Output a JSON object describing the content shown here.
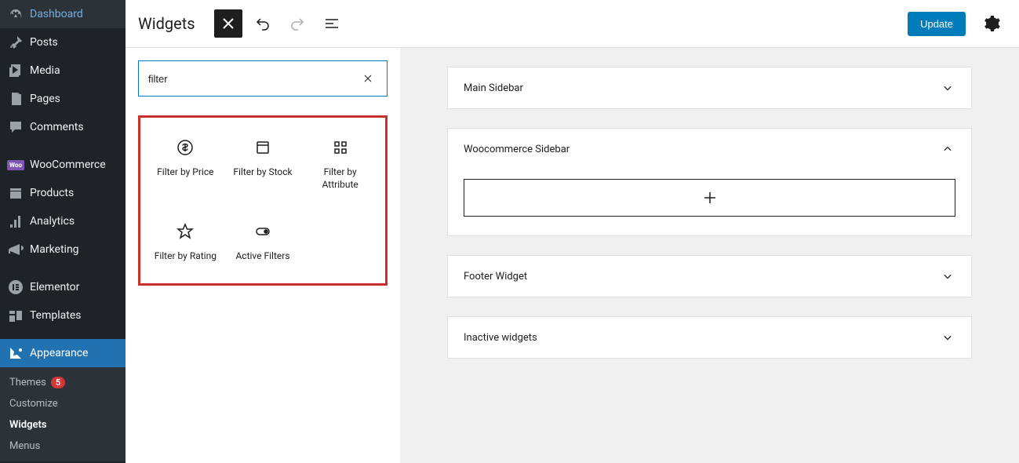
{
  "sidebar": {
    "items": [
      {
        "label": "Dashboard",
        "icon": "dashboard"
      },
      {
        "label": "Posts",
        "icon": "pin"
      },
      {
        "label": "Media",
        "icon": "media"
      },
      {
        "label": "Pages",
        "icon": "pages"
      },
      {
        "label": "Comments",
        "icon": "comments"
      },
      {
        "label": "WooCommerce",
        "icon": "woo"
      },
      {
        "label": "Products",
        "icon": "products"
      },
      {
        "label": "Analytics",
        "icon": "analytics"
      },
      {
        "label": "Marketing",
        "icon": "marketing"
      },
      {
        "label": "Elementor",
        "icon": "elementor"
      },
      {
        "label": "Templates",
        "icon": "templates"
      },
      {
        "label": "Appearance",
        "icon": "appearance"
      }
    ],
    "submenu": [
      {
        "label": "Themes",
        "badge": "5"
      },
      {
        "label": "Customize"
      },
      {
        "label": "Widgets",
        "current": true
      },
      {
        "label": "Menus"
      }
    ]
  },
  "header": {
    "title": "Widgets",
    "update_label": "Update"
  },
  "search": {
    "value": "filter"
  },
  "blocks": [
    {
      "label": "Filter by Price",
      "icon": "price"
    },
    {
      "label": "Filter by Stock",
      "icon": "stock"
    },
    {
      "label": "Filter by Attribute",
      "icon": "attribute"
    },
    {
      "label": "Filter by Rating",
      "icon": "rating"
    },
    {
      "label": "Active Filters",
      "icon": "active"
    }
  ],
  "widget_areas": [
    {
      "title": "Main Sidebar",
      "expanded": false
    },
    {
      "title": "Woocommerce Sidebar",
      "expanded": true
    },
    {
      "title": "Footer Widget",
      "expanded": false
    },
    {
      "title": "Inactive widgets",
      "expanded": false
    }
  ]
}
